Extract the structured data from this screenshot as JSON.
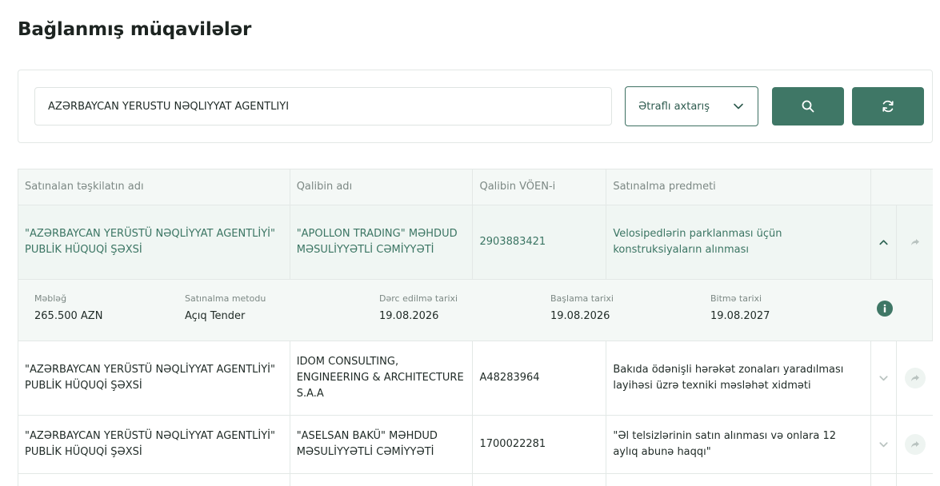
{
  "page": {
    "title": "Bağlanmış müqavilələr"
  },
  "search": {
    "value": "AZƏRBAYCAN YERÜSTÜ NƏQLİYYAT AGENTLİYİ",
    "advanced_label": "Ətraflı axtarış"
  },
  "table": {
    "headers": [
      "Satınalan təşkilatın adı",
      "Qalibin adı",
      "Qalibin VÖEN-i",
      "Satınalma predmeti"
    ],
    "rows": [
      {
        "org": "\"AZƏRBAYCAN YERÜSTÜ NƏQLİYYAT AGENTLİYİ\" PUBLİK HÜQUQİ ŞƏXSİ",
        "winner": "\"APOLLON TRADING\" MƏHDUD MƏSULİYYƏTLİ CƏMİYYƏTİ",
        "voen": "2903883421",
        "subject": "Velosipedlərin parklanması üçün konstruksiyaların alınması",
        "expanded": true,
        "details": {
          "amount_label": "Məbləğ",
          "amount": "265.500 AZN",
          "method_label": "Satınalma metodu",
          "method": "Açıq Tender",
          "published_label": "Dərc edilmə tarixi",
          "published": "19.08.2026",
          "start_label": "Başlama tarixi",
          "start": "19.08.2026",
          "end_label": "Bitmə tarixi",
          "end": "19.08.2027"
        }
      },
      {
        "org": "\"AZƏRBAYCAN YERÜSTÜ NƏQLİYYAT AGENTLİYİ\" PUBLİK HÜQUQİ ŞƏXSİ",
        "winner": "IDOM CONSULTING, ENGINEERING & ARCHITECTURE S.A.A",
        "voen": "A48283964",
        "subject": "Bakıda ödənişli hərəkət zonaları yaradılması layihəsi üzrə texniki məsləhət xidməti",
        "expanded": false
      },
      {
        "org": "\"AZƏRBAYCAN YERÜSTÜ NƏQLİYYAT AGENTLİYİ\" PUBLİK HÜQUQİ ŞƏXSİ",
        "winner": "\"ASELSAN BAKÜ\" MƏHDUD MƏSULİYYƏTLİ CƏMİYYƏTİ",
        "voen": "1700022281",
        "subject": "\"Əl telsizlərinin satın alınması və onlara 12 aylıq abunə haqqı\"",
        "expanded": false
      }
    ]
  },
  "colors": {
    "accent": "#3f7766",
    "accent_text": "#3b7563",
    "border": "#e3e8e6"
  }
}
